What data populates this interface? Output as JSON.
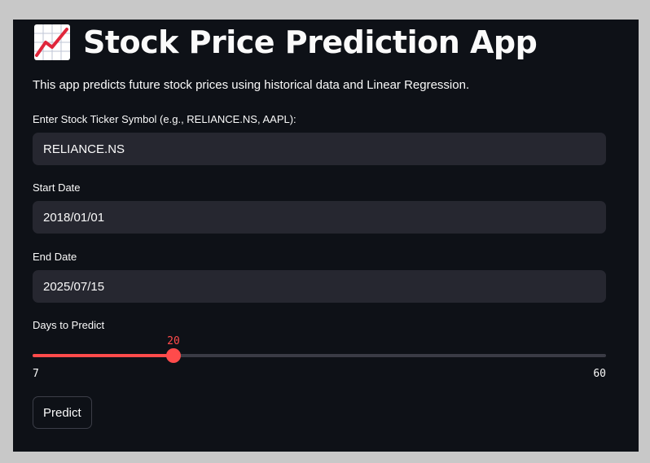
{
  "title": {
    "icon": "chart-increasing-emoji",
    "text": "Stock Price Prediction App"
  },
  "intro": "This app predicts future stock prices using historical data and Linear Regression.",
  "fields": {
    "ticker": {
      "label": "Enter Stock Ticker Symbol (e.g., RELIANCE.NS, AAPL):",
      "value": "RELIANCE.NS"
    },
    "start_date": {
      "label": "Start Date",
      "value": "2018/01/01"
    },
    "end_date": {
      "label": "End Date",
      "value": "2025/07/15"
    }
  },
  "slider": {
    "label": "Days to Predict",
    "value": 20,
    "min": 7,
    "max": 60,
    "min_label": "7",
    "max_label": "60",
    "value_label": "20"
  },
  "predict_button": "Predict",
  "colors": {
    "background": "#0e1117",
    "input": "#262730",
    "accent": "#ff4b4b",
    "text": "#fafafa"
  }
}
